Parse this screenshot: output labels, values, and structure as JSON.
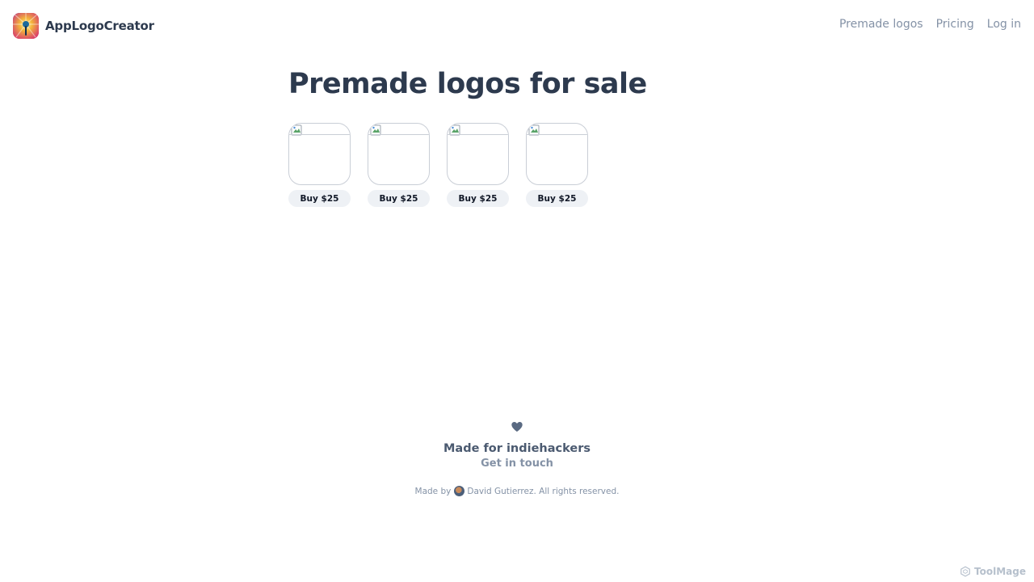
{
  "brand": {
    "name": "AppLogoCreator",
    "logo_icon": "sunburst-app-logo-icon"
  },
  "nav": [
    {
      "label": "Premade logos"
    },
    {
      "label": "Pricing"
    },
    {
      "label": "Log in"
    }
  ],
  "main": {
    "title": "Premade logos for sale",
    "logos": [
      {
        "buy_label": "Buy $25"
      },
      {
        "buy_label": "Buy $25"
      },
      {
        "buy_label": "Buy $25"
      },
      {
        "buy_label": "Buy $25"
      }
    ]
  },
  "footer": {
    "icon": "heart-icon",
    "tagline": "Made for indiehackers",
    "contact_label": "Get in touch",
    "made_by_prefix": "Made by",
    "author": "David Gutierrez.",
    "rights": "All rights reserved."
  },
  "watermark": {
    "label": "ToolMage"
  },
  "colors": {
    "text_dark": "#2d3a4e",
    "text_muted": "#8492a6",
    "button_bg": "#eef1f5",
    "card_border": "#c9ced6"
  }
}
